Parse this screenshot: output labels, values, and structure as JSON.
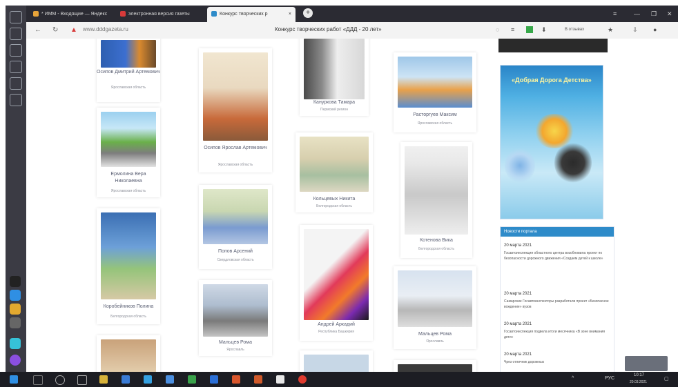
{
  "browser": {
    "tabs": [
      {
        "label": "* ИММ - Входящие — Яндекс",
        "favicon_color": "#e8a43a"
      },
      {
        "label": "электронная версия газеты",
        "favicon_color": "#d83a3a"
      },
      {
        "label": "Конкурс творческих р",
        "favicon_color": "#2e8bc9",
        "active": true
      }
    ],
    "new_tab": "+",
    "url": "www.dddgazeta.ru",
    "page_title": "Конкурс творческих работ «ДДД - 20 лет»",
    "toolbar_text": "В отзывах"
  },
  "cards": [
    {
      "name": "Осипов Дмитрий Артемович",
      "region": "Ярославская область"
    },
    {
      "name": "Ермолина Вера Николаевна",
      "region": "Ярославская область"
    },
    {
      "name": "Коробейников Полина",
      "region": "Белгородская область"
    },
    {
      "name": "Осипов Ярослав Артемович",
      "region": "Ярославская область"
    },
    {
      "name": "Попов Арсений",
      "region": "Свердловская область"
    },
    {
      "name": "Мальцев Рома",
      "region": "Ярославль"
    },
    {
      "name": "Кануркова Тамара",
      "region": "Пермский регион"
    },
    {
      "name": "Кольцевых Никита",
      "region": "Белгородская область"
    },
    {
      "name": "Андрей Аркадий",
      "region": "Республика Башкирия"
    },
    {
      "name": "Расторгуев Максим",
      "region": "Ярославская область"
    },
    {
      "name": "Котенова Вика",
      "region": "Белгородская область"
    },
    {
      "name": "Мальцев Рома",
      "region": "Ярославль"
    }
  ],
  "poster": {
    "title": "«Добрая Дорога Детства»"
  },
  "news": {
    "header": "Новости портала",
    "items": [
      {
        "date": "20 марта 2021",
        "text": "Госавтоинспекция областного центра возобновила проект по безопасности дорожного движения «Создаем детей к школе»"
      },
      {
        "date": "20 марта 2021",
        "text": "Самарские Госавтоинспекторы разработали проект «Безопасное вождение» вузов"
      },
      {
        "date": "20 марта 2021",
        "text": "Госавтоинспекция подвела итоги месячника «В зоне внимания дети»"
      },
      {
        "date": "20 марта 2021",
        "text": "Чрез отличник дорожных"
      }
    ]
  },
  "taskbar": {
    "time": "10:17",
    "date": "20.03.2021",
    "lang": "РУС"
  }
}
